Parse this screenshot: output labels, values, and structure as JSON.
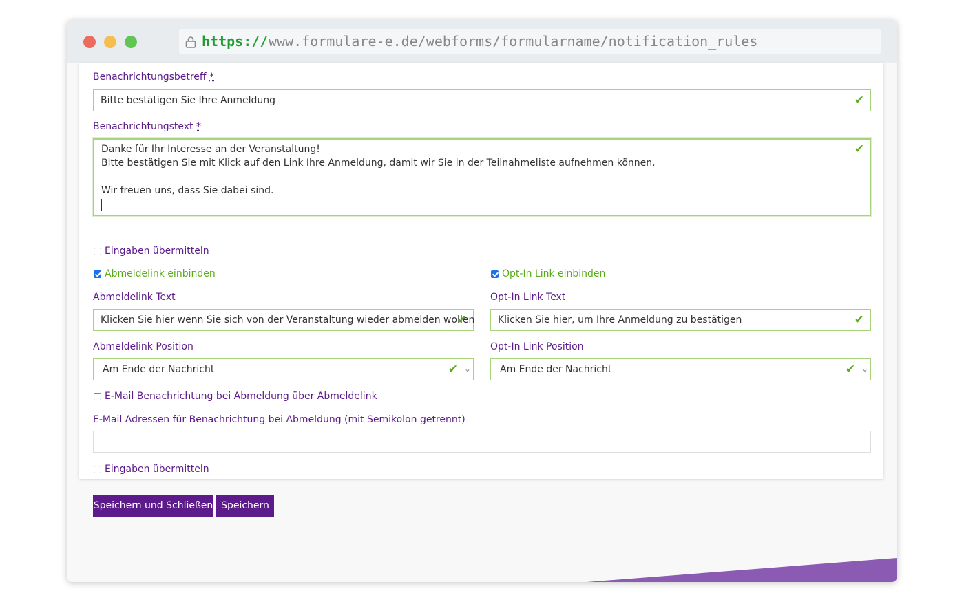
{
  "browser": {
    "url_scheme": "https://",
    "url_rest": "www.formulare-e.de/webforms/formularname/notification_rules"
  },
  "form": {
    "subject": {
      "label": "Benachrichtungsbetreff",
      "required_mark": "*",
      "value": "Bitte bestätigen Sie Ihre Anmeldung"
    },
    "body": {
      "label": "Benachrichtungstext",
      "required_mark": "*",
      "lines": [
        "Danke für Ihr Interesse an der Veranstaltung!",
        "Bitte bestätigen Sie mit Klick auf den Link Ihre Anmeldung, damit wir Sie in der Teilnahmeliste aufnehmen können.",
        "",
        "Wir freuen uns, dass Sie dabei sind."
      ]
    },
    "submit_inputs_1": {
      "label": "Eingaben übermitteln",
      "checked": false
    },
    "unsubscribe": {
      "checkbox_label": "Abmeldelink einbinden",
      "checked": true,
      "text_label": "Abmeldelink Text",
      "text_value": "Klicken Sie hier wenn Sie sich von der Veranstaltung wieder abmelden wollen",
      "position_label": "Abmeldelink Position",
      "position_value": "Am Ende der Nachricht"
    },
    "optin": {
      "checkbox_label": "Opt-In Link einbinden",
      "checked": true,
      "text_label": "Opt-In Link Text",
      "text_value": "Klicken Sie hier, um Ihre Anmeldung zu bestätigen",
      "position_label": "Opt-In Link Position",
      "position_value": "Am Ende der Nachricht"
    },
    "email_notify": {
      "label": "E-Mail Benachrichtung bei Abmeldung über Abmeldelink",
      "checked": false
    },
    "email_addresses": {
      "label": "E-Mail Adressen für Benachrichtung bei Abmeldung (mit Semikolon getrennt)",
      "value": ""
    },
    "submit_inputs_2": {
      "label": "Eingaben übermitteln",
      "checked": false
    }
  },
  "actions": {
    "save_close": "Speichern und Schließen",
    "save": "Speichern"
  },
  "colors": {
    "brand": "#5c1a8a",
    "valid": "#5aab1a",
    "accent_wedge": "#8b5ab3"
  },
  "icons": {
    "valid": "check-icon",
    "secure": "lock-icon",
    "select": "chevron-down-icon"
  }
}
